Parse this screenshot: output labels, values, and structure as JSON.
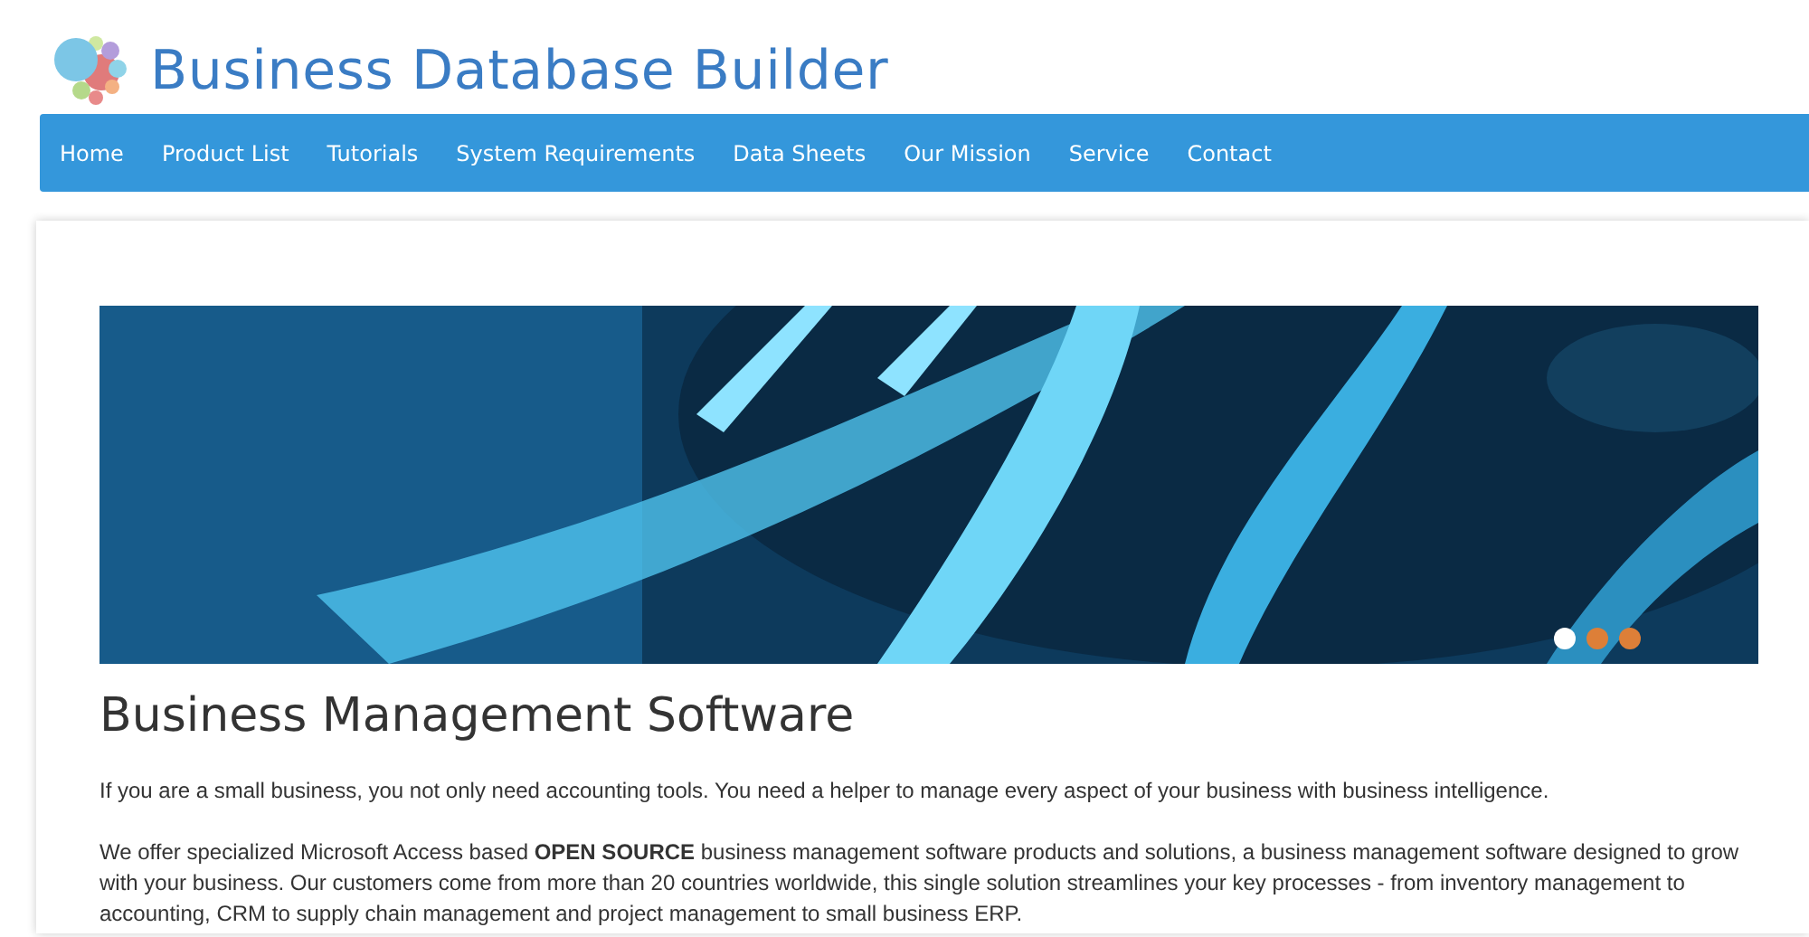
{
  "site_title": "Business Database Builder",
  "nav": [
    {
      "label": "Home"
    },
    {
      "label": "Product List"
    },
    {
      "label": "Tutorials"
    },
    {
      "label": "System Requirements"
    },
    {
      "label": "Data Sheets"
    },
    {
      "label": "Our Mission"
    },
    {
      "label": "Service"
    },
    {
      "label": "Contact"
    }
  ],
  "slider": {
    "dots": [
      {
        "selected": true
      },
      {
        "selected": false
      },
      {
        "selected": false
      }
    ]
  },
  "heading": "Business Management Software",
  "paragraphs": [
    "If you are a small business, you not only need accounting tools. You need a helper to manage every aspect of your business with business intelligence.",
    "We offer specialized Microsoft Access based **OPEN SOURCE** business management software products and solutions, a business management software designed to grow with your business. Our customers come from more than 20 countries worldwide, this single solution streamlines your key processes - from inventory management to accounting, CRM to supply chain management and project management to small business ERP."
  ]
}
